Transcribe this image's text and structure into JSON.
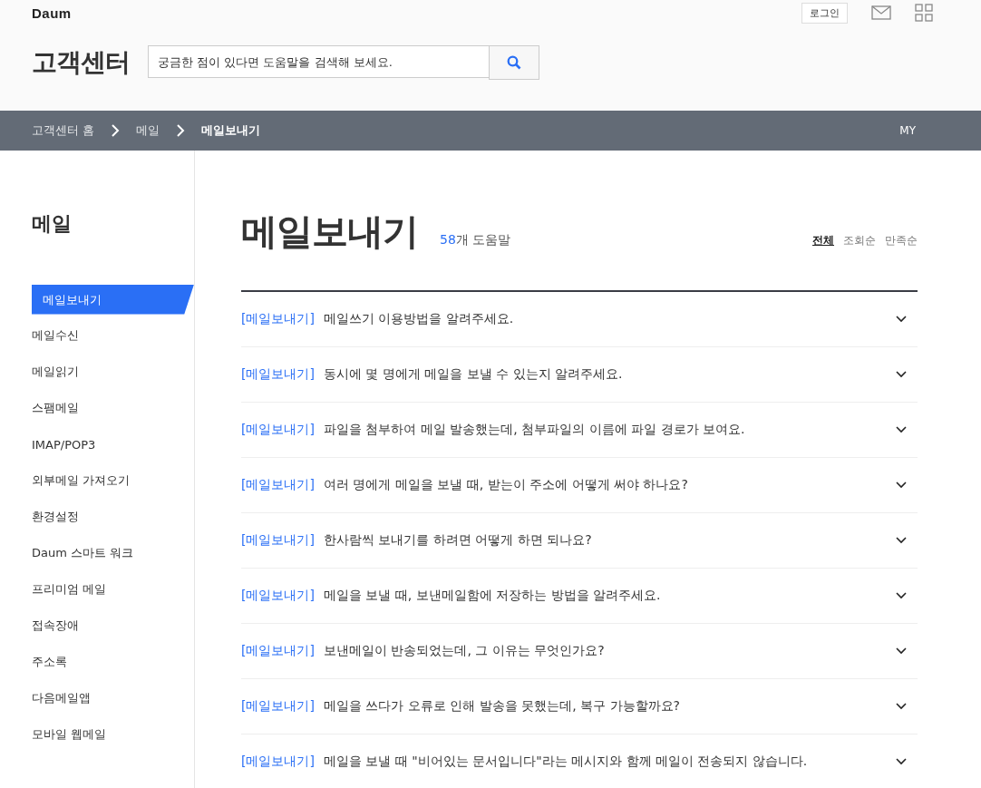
{
  "header": {
    "logo": "Daum",
    "login": "로그인",
    "title": "고객센터",
    "search": {
      "placeholder": "궁금한 점이 있다면 도움말을 검색해 보세요."
    }
  },
  "breadcrumb": {
    "items": [
      {
        "label": "고객센터 홈",
        "selected": false
      },
      {
        "label": "메일",
        "selected": false
      },
      {
        "label": "메일보내기",
        "selected": true
      }
    ],
    "my": "MY"
  },
  "sidebar": {
    "title": "메일",
    "items": [
      {
        "label": "메일보내기",
        "selected": true
      },
      {
        "label": "메일수신",
        "selected": false
      },
      {
        "label": "메일읽기",
        "selected": false
      },
      {
        "label": "스팸메일",
        "selected": false
      },
      {
        "label": "IMAP/POP3",
        "selected": false
      },
      {
        "label": "외부메일 가져오기",
        "selected": false
      },
      {
        "label": "환경설정",
        "selected": false
      },
      {
        "label": "Daum 스마트 워크",
        "selected": false
      },
      {
        "label": "프리미엄 메일",
        "selected": false
      },
      {
        "label": "접속장애",
        "selected": false
      },
      {
        "label": "주소록",
        "selected": false
      },
      {
        "label": "다음메일앱",
        "selected": false
      },
      {
        "label": "모바일 웹메일",
        "selected": false
      }
    ]
  },
  "content": {
    "title": "메일보내기",
    "count": "58",
    "count_suffix": "개 도움말",
    "sort": [
      {
        "label": "전체",
        "selected": true
      },
      {
        "label": "조회순",
        "selected": false
      },
      {
        "label": "만족순",
        "selected": false
      }
    ],
    "questions": [
      {
        "category": "[메일보내기]",
        "text": "메일쓰기 이용방법을 알려주세요."
      },
      {
        "category": "[메일보내기]",
        "text": "동시에 몇 명에게 메일을 보낼 수 있는지 알려주세요."
      },
      {
        "category": "[메일보내기]",
        "text": "파일을 첨부하여 메일 발송했는데, 첨부파일의 이름에 파일 경로가 보여요."
      },
      {
        "category": "[메일보내기]",
        "text": "여러 명에게 메일을 보낼 때, 받는이 주소에 어떻게 써야 하나요?"
      },
      {
        "category": "[메일보내기]",
        "text": "한사람씩 보내기를 하려면 어떻게 하면 되나요?"
      },
      {
        "category": "[메일보내기]",
        "text": "메일을 보낼 때, 보낸메일함에 저장하는 방법을 알려주세요."
      },
      {
        "category": "[메일보내기]",
        "text": "보낸메일이 반송되었는데, 그 이유는 무엇인가요?"
      },
      {
        "category": "[메일보내기]",
        "text": "메일을 쓰다가 오류로 인해 발송을 못했는데, 복구 가능할까요?"
      },
      {
        "category": "[메일보내기]",
        "text": "메일을 보낼 때 \"비어있는 문서입니다\"라는 메시지와 함께 메일이 전송되지 않습니다."
      }
    ]
  }
}
